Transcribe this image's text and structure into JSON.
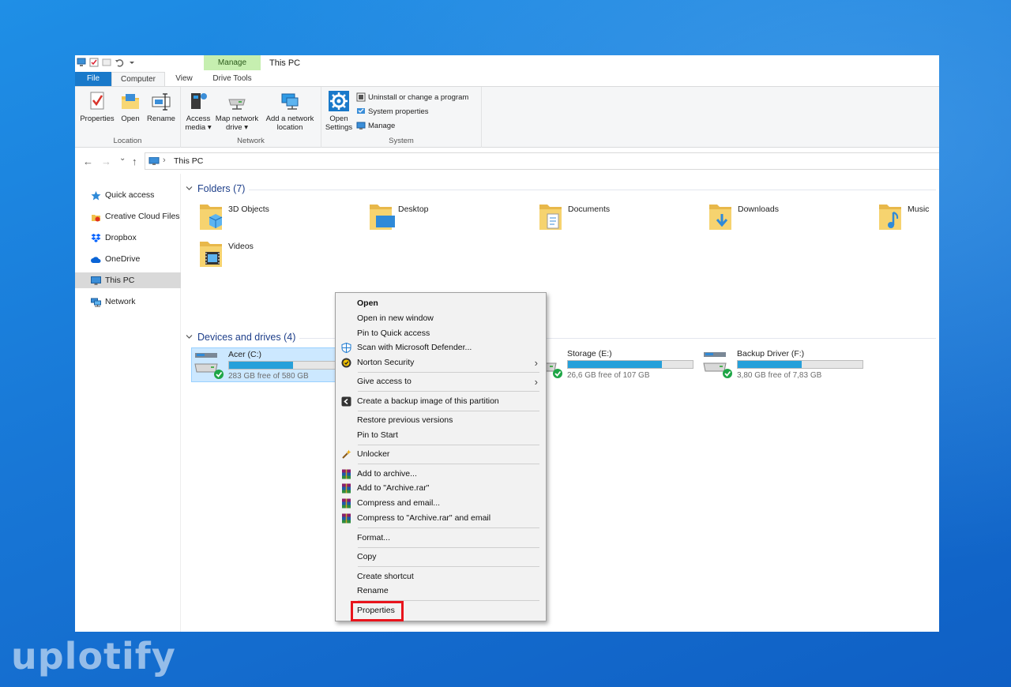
{
  "window": {
    "title": "This PC",
    "manage_label": "Manage"
  },
  "ribbon_tabs": {
    "file": "File",
    "computer": "Computer",
    "view": "View",
    "drive_tools": "Drive Tools"
  },
  "ribbon": {
    "location": {
      "label": "Location",
      "properties": "Properties",
      "open": "Open",
      "rename": "Rename"
    },
    "network": {
      "label": "Network",
      "access_media_1": "Access",
      "access_media_2": "media ▾",
      "map_drive_1": "Map network",
      "map_drive_2": "drive ▾",
      "add_location_1": "Add a network",
      "add_location_2": "location"
    },
    "system": {
      "label": "System",
      "open_settings_1": "Open",
      "open_settings_2": "Settings",
      "uninstall": "Uninstall or change a program",
      "system_properties": "System properties",
      "manage": "Manage"
    }
  },
  "navigation": {
    "back": "←",
    "forward": "→",
    "recent": "⌄",
    "up": "↑",
    "separator": "›",
    "address": "This PC"
  },
  "sidebar": {
    "items": [
      {
        "label": "Quick access",
        "icon": "star-icon"
      },
      {
        "label": "Creative Cloud Files",
        "icon": "creative-cloud-icon"
      },
      {
        "label": "Dropbox",
        "icon": "dropbox-icon"
      },
      {
        "label": "OneDrive",
        "icon": "cloud-icon"
      },
      {
        "label": "This PC",
        "icon": "computer-icon"
      },
      {
        "label": "Network",
        "icon": "network-icon"
      }
    ]
  },
  "folders": {
    "heading": "Folders (7)",
    "items": [
      {
        "label": "3D Objects"
      },
      {
        "label": "Desktop"
      },
      {
        "label": "Documents"
      },
      {
        "label": "Downloads"
      },
      {
        "label": "Music"
      },
      {
        "label": "Videos"
      }
    ]
  },
  "drives": {
    "heading": "Devices and drives (4)",
    "items": [
      {
        "name": "Acer (C:)",
        "free": "283 GB free of 580 GB",
        "used_fraction": 0.51
      },
      {
        "name": "Storage (E:)",
        "free": "26,6 GB free of 107 GB",
        "used_fraction": 0.75
      },
      {
        "name": "Backup Driver (F:)",
        "free": "3,80 GB free of 7,83 GB",
        "used_fraction": 0.51
      }
    ]
  },
  "context_menu": {
    "items": [
      "Open",
      "Open in new window",
      "Pin to Quick access",
      "Scan with Microsoft Defender...",
      "Norton Security",
      "Give access to",
      "Create a backup image of this partition",
      "Restore previous versions",
      "Pin to Start",
      "Unlocker",
      "Add to archive...",
      "Add to \"Archive.rar\"",
      "Compress and email...",
      "Compress to \"Archive.rar\" and email",
      "Format...",
      "Copy",
      "Create shortcut",
      "Rename",
      "Properties"
    ],
    "submenu_arrow": "›"
  },
  "watermark": {
    "text": "uplotify"
  },
  "colors": {
    "accent": "#1979ca",
    "drive_bar": "#26a0da",
    "highlight": "#e8141c",
    "manage_tab": "#c6efb0"
  }
}
